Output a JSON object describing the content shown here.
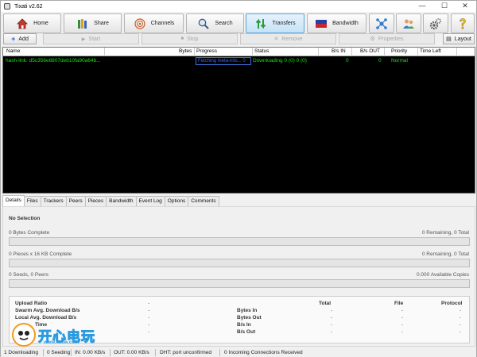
{
  "window": {
    "title": "Tixati v2.62",
    "minimize": "—",
    "maximize": "☐",
    "close": "✕"
  },
  "toolbar": {
    "home": "Home",
    "share": "Share",
    "channels": "Channels",
    "search": "Search",
    "transfers": "Transfers",
    "bandwidth": "Bandwidth"
  },
  "subbar": {
    "add": "Add",
    "start": "Start",
    "stop": "Stop",
    "remove": "Remove",
    "properties": "Properties",
    "layout": "Layout"
  },
  "transfers": {
    "columns": [
      "Name",
      "Bytes",
      "Progress",
      "Status",
      "B/s IN",
      "B/s OUT",
      "Priority",
      "Time Left"
    ],
    "rows": [
      {
        "name": "hash-link: d5c356e8807deb10fa90a64b...",
        "bytes": "",
        "progress": "Fetching meta-info... 0",
        "status": "Downloading 0 (0) 0 (0)",
        "bps_in": "0",
        "bps_out": "0",
        "priority": "Normal",
        "time_left": ""
      }
    ]
  },
  "tabs": [
    "Details",
    "Files",
    "Trackers",
    "Peers",
    "Pieces",
    "Bandwidth",
    "Event Log",
    "Options",
    "Comments"
  ],
  "details": {
    "selection": "No Selection",
    "bytes_complete": "0 Bytes Complete",
    "bytes_remaining": "0 Remaining,  0 Total",
    "pieces_complete": "0 Pieces  x  16 KB Complete",
    "pieces_remaining": "0 Remaining,  0 Total",
    "seeds_peers": "0 Seeds, 0 Peers",
    "available_copies": "0.000 Available Copies",
    "stats": {
      "upload_ratio": "Upload Ratio",
      "swarm_avg": "Swarm Avg. Download B/s",
      "local_avg": "Local Avg. Download B/s",
      "time": "Time",
      "dash": "-",
      "col_total": "Total",
      "col_file": "File",
      "col_protocol": "Protocol",
      "bytes_in": "Bytes In",
      "bytes_out": "Bytes Out",
      "bps_in": "B/s In",
      "bps_out": "B/s Out"
    }
  },
  "statusbar": {
    "downloading": "1 Downloading",
    "seeding": "0 Seeding",
    "in": "IN: 0.00 KB/s",
    "out": "OUT: 0.00 KB/s",
    "dht": "DHT: port unconfirmed",
    "incoming": "0 Incoming Connections Received"
  },
  "watermark": {
    "text": "开心电玩",
    "url": "www.kxdw.com"
  },
  "colors": {
    "list_text": "#19e019",
    "progress_text": "#2f6ff5",
    "accent": "#5ba1d6"
  }
}
